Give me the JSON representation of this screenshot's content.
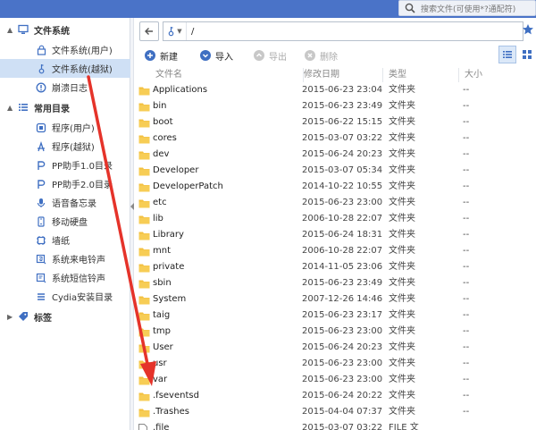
{
  "search": {
    "placeholder": "搜索文件(可使用*?通配符)"
  },
  "sidebar": {
    "groups": [
      {
        "label": "文件系统",
        "icon": "monitor-icon"
      },
      {
        "label": "常用目录",
        "icon": "list-icon"
      },
      {
        "label": "标签",
        "icon": "tag-icon"
      }
    ],
    "items": [
      {
        "label": "文件系统(用户)",
        "icon": "lock-icon"
      },
      {
        "label": "文件系统(越狱)",
        "icon": "key-icon",
        "selected": true
      },
      {
        "label": "崩溃日志",
        "icon": "alert-icon"
      },
      {
        "label": "程序(用户)",
        "icon": "app-icon"
      },
      {
        "label": "程序(越狱)",
        "icon": "app-store-icon"
      },
      {
        "label": "PP助手1.0目录",
        "icon": "pp-icon"
      },
      {
        "label": "PP助手2.0目录",
        "icon": "pp-icon"
      },
      {
        "label": "语音备忘录",
        "icon": "microphone-icon"
      },
      {
        "label": "移动硬盘",
        "icon": "disk-icon"
      },
      {
        "label": "墙纸",
        "icon": "wallpaper-icon"
      },
      {
        "label": "系统来电铃声",
        "icon": "ringtone-icon"
      },
      {
        "label": "系统短信铃声",
        "icon": "sms-tone-icon"
      },
      {
        "label": "Cydia安装目录",
        "icon": "cydia-icon"
      }
    ]
  },
  "address": {
    "path": "/"
  },
  "toolbar": {
    "new_label": "新建",
    "import_label": "导入",
    "export_label": "导出",
    "delete_label": "删除"
  },
  "table": {
    "headers": {
      "name": "文件名",
      "date": "修改日期",
      "type": "类型",
      "size": "大小"
    },
    "rows": [
      {
        "name": "Applications",
        "date": "2015-06-23 23:04",
        "type": "文件夹",
        "size": "--",
        "kind": "folder"
      },
      {
        "name": "bin",
        "date": "2015-06-23 23:49",
        "type": "文件夹",
        "size": "--",
        "kind": "folder"
      },
      {
        "name": "boot",
        "date": "2015-06-22 15:15",
        "type": "文件夹",
        "size": "--",
        "kind": "folder"
      },
      {
        "name": "cores",
        "date": "2015-03-07 03:22",
        "type": "文件夹",
        "size": "--",
        "kind": "folder"
      },
      {
        "name": "dev",
        "date": "2015-06-24 20:23",
        "type": "文件夹",
        "size": "--",
        "kind": "folder"
      },
      {
        "name": "Developer",
        "date": "2015-03-07 05:34",
        "type": "文件夹",
        "size": "--",
        "kind": "folder"
      },
      {
        "name": "DeveloperPatch",
        "date": "2014-10-22 10:55",
        "type": "文件夹",
        "size": "--",
        "kind": "folder"
      },
      {
        "name": "etc",
        "date": "2015-06-23 23:00",
        "type": "文件夹",
        "size": "--",
        "kind": "folder"
      },
      {
        "name": "lib",
        "date": "2006-10-28 22:07",
        "type": "文件夹",
        "size": "--",
        "kind": "folder"
      },
      {
        "name": "Library",
        "date": "2015-06-24 18:31",
        "type": "文件夹",
        "size": "--",
        "kind": "folder"
      },
      {
        "name": "mnt",
        "date": "2006-10-28 22:07",
        "type": "文件夹",
        "size": "--",
        "kind": "folder"
      },
      {
        "name": "private",
        "date": "2014-11-05 23:06",
        "type": "文件夹",
        "size": "--",
        "kind": "folder"
      },
      {
        "name": "sbin",
        "date": "2015-06-23 23:49",
        "type": "文件夹",
        "size": "--",
        "kind": "folder"
      },
      {
        "name": "System",
        "date": "2007-12-26 14:46",
        "type": "文件夹",
        "size": "--",
        "kind": "folder"
      },
      {
        "name": "taig",
        "date": "2015-06-23 23:17",
        "type": "文件夹",
        "size": "--",
        "kind": "folder"
      },
      {
        "name": "tmp",
        "date": "2015-06-23 23:00",
        "type": "文件夹",
        "size": "--",
        "kind": "folder"
      },
      {
        "name": "User",
        "date": "2015-06-24 20:23",
        "type": "文件夹",
        "size": "--",
        "kind": "folder"
      },
      {
        "name": "usr",
        "date": "2015-06-23 23:00",
        "type": "文件夹",
        "size": "--",
        "kind": "folder"
      },
      {
        "name": "var",
        "date": "2015-06-23 23:00",
        "type": "文件夹",
        "size": "--",
        "kind": "folder"
      },
      {
        "name": ".fseventsd",
        "date": "2015-06-24 20:22",
        "type": "文件夹",
        "size": "--",
        "kind": "folder"
      },
      {
        "name": ".Trashes",
        "date": "2015-04-04 07:37",
        "type": "文件夹",
        "size": "--",
        "kind": "folder"
      },
      {
        "name": ".file",
        "date": "2015-03-07 03:22",
        "type": "FILE 文",
        "size": "",
        "kind": "file"
      }
    ]
  },
  "colors": {
    "titlebar": "#4a73c8",
    "accent": "#3f6fc2",
    "selected_row": "#cfe0f5",
    "folder": "#f3c040",
    "annotation_arrow": "#e5332a"
  }
}
